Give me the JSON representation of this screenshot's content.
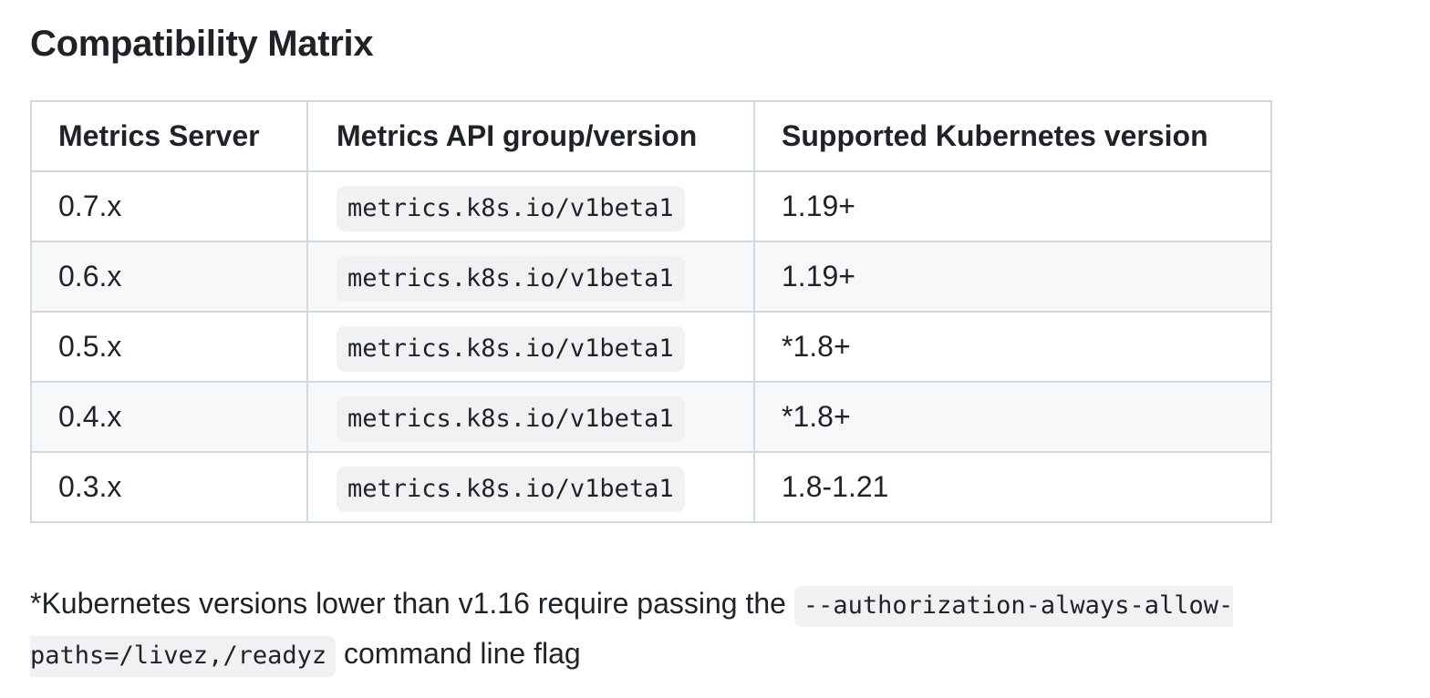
{
  "heading": "Compatibility Matrix",
  "table": {
    "headers": [
      "Metrics Server",
      "Metrics API group/version",
      "Supported Kubernetes version"
    ],
    "rows": [
      [
        "0.7.x",
        "metrics.k8s.io/v1beta1",
        "1.19+"
      ],
      [
        "0.6.x",
        "metrics.k8s.io/v1beta1",
        "1.19+"
      ],
      [
        "0.5.x",
        "metrics.k8s.io/v1beta1",
        "*1.8+"
      ],
      [
        "0.4.x",
        "metrics.k8s.io/v1beta1",
        "*1.8+"
      ],
      [
        "0.3.x",
        "metrics.k8s.io/v1beta1",
        "1.8-1.21"
      ]
    ]
  },
  "footnote": {
    "prefix": "*Kubernetes versions lower than v1.16 require passing the",
    "flag": "--authorization-always-allow-paths=/livez,/readyz",
    "suffix": "command line flag"
  }
}
